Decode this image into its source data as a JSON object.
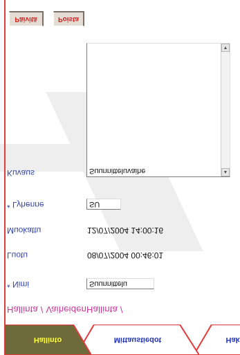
{
  "tabs": [
    {
      "label": "Hallinto",
      "active": true
    },
    {
      "label": "Mittaustiedot",
      "active": false
    },
    {
      "label": "Haku",
      "active": false
    }
  ],
  "breadcrumb": "Hallinta / VaiheidenHallinta /",
  "fields": {
    "nimi": {
      "label": "* Nimi",
      "value": "Suunnittelu"
    },
    "luotu": {
      "label": "Luotu",
      "value": "08/07/2004 00:46:01"
    },
    "muokattu": {
      "label": "Muokattu",
      "value": "12/07/2004 14:00:16"
    },
    "lyhenne": {
      "label": "* Lyhenne",
      "value": "SU"
    },
    "kuvaus": {
      "label": "Kuvaus",
      "value": "Suunnitteluvaihe"
    }
  },
  "buttons": {
    "paivita": "Päivitä",
    "poista": "Poista"
  },
  "colors": {
    "active_tab": "#6e6a3a",
    "inactive_tab": "#ffffff",
    "frame_red": "#e23a3a",
    "label_blue": "#3344aa",
    "breadcrumb_pink": "#cc3399"
  }
}
